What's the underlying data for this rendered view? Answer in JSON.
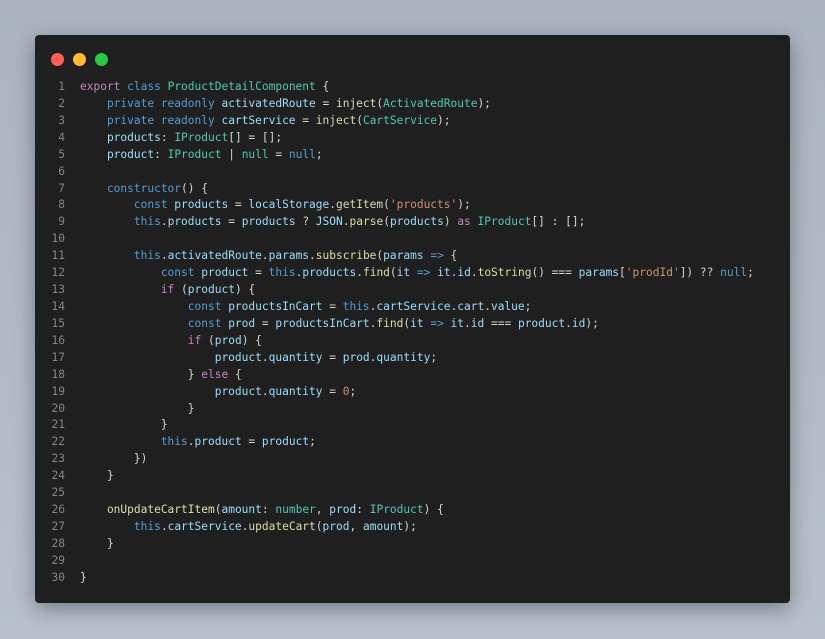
{
  "window": {
    "controls": [
      {
        "name": "close",
        "color": "#ff5f57"
      },
      {
        "name": "minimize",
        "color": "#febc2e"
      },
      {
        "name": "maximize",
        "color": "#28c840"
      }
    ]
  },
  "code": {
    "language": "typescript",
    "lines": [
      [
        [
          "export ",
          "c"
        ],
        [
          "class ",
          "k"
        ],
        [
          "ProductDetailComponent ",
          "t"
        ],
        [
          "{",
          "p"
        ]
      ],
      [
        [
          "    private readonly ",
          "k"
        ],
        [
          "activatedRoute",
          "v"
        ],
        [
          " = ",
          "p"
        ],
        [
          "inject",
          "f"
        ],
        [
          "(",
          "p"
        ],
        [
          "ActivatedRoute",
          "t"
        ],
        [
          ");",
          "p"
        ]
      ],
      [
        [
          "    private readonly ",
          "k"
        ],
        [
          "cartService",
          "v"
        ],
        [
          " = ",
          "p"
        ],
        [
          "inject",
          "f"
        ],
        [
          "(",
          "p"
        ],
        [
          "CartService",
          "t"
        ],
        [
          ");",
          "p"
        ]
      ],
      [
        [
          "    products",
          "v"
        ],
        [
          ": ",
          "p"
        ],
        [
          "IProduct",
          "t"
        ],
        [
          "[] = [];",
          "p"
        ]
      ],
      [
        [
          "    product",
          "v"
        ],
        [
          ": ",
          "p"
        ],
        [
          "IProduct",
          "t"
        ],
        [
          " | ",
          "p"
        ],
        [
          "null",
          "t"
        ],
        [
          " = ",
          "p"
        ],
        [
          "null",
          "k"
        ],
        [
          ";",
          "p"
        ]
      ],
      [],
      [
        [
          "    constructor",
          "k"
        ],
        [
          "() {",
          "p"
        ]
      ],
      [
        [
          "        const ",
          "k"
        ],
        [
          "products",
          "v"
        ],
        [
          " = ",
          "p"
        ],
        [
          "localStorage",
          "v"
        ],
        [
          ".",
          "p"
        ],
        [
          "getItem",
          "f"
        ],
        [
          "(",
          "p"
        ],
        [
          "'products'",
          "s"
        ],
        [
          ");",
          "p"
        ]
      ],
      [
        [
          "        this",
          "k"
        ],
        [
          ".",
          "p"
        ],
        [
          "products",
          "v"
        ],
        [
          " = ",
          "p"
        ],
        [
          "products",
          "v"
        ],
        [
          " ? ",
          "p"
        ],
        [
          "JSON",
          "v"
        ],
        [
          ".",
          "p"
        ],
        [
          "parse",
          "f"
        ],
        [
          "(",
          "p"
        ],
        [
          "products",
          "v"
        ],
        [
          ") ",
          "p"
        ],
        [
          "as ",
          "c"
        ],
        [
          "IProduct",
          "t"
        ],
        [
          "[] : [];",
          "p"
        ]
      ],
      [],
      [
        [
          "        this",
          "k"
        ],
        [
          ".",
          "p"
        ],
        [
          "activatedRoute",
          "v"
        ],
        [
          ".",
          "p"
        ],
        [
          "params",
          "v"
        ],
        [
          ".",
          "p"
        ],
        [
          "subscribe",
          "f"
        ],
        [
          "(",
          "p"
        ],
        [
          "params",
          "v"
        ],
        [
          " => ",
          "k"
        ],
        [
          "{",
          "p"
        ]
      ],
      [
        [
          "            const ",
          "k"
        ],
        [
          "product",
          "v"
        ],
        [
          " = ",
          "p"
        ],
        [
          "this",
          "k"
        ],
        [
          ".",
          "p"
        ],
        [
          "products",
          "v"
        ],
        [
          ".",
          "p"
        ],
        [
          "find",
          "f"
        ],
        [
          "(",
          "p"
        ],
        [
          "it",
          "v"
        ],
        [
          " => ",
          "k"
        ],
        [
          "it",
          "v"
        ],
        [
          ".",
          "p"
        ],
        [
          "id",
          "v"
        ],
        [
          ".",
          "p"
        ],
        [
          "toString",
          "f"
        ],
        [
          "() === ",
          "p"
        ],
        [
          "params",
          "v"
        ],
        [
          "[",
          "p"
        ],
        [
          "'prodId'",
          "s"
        ],
        [
          "]) ?? ",
          "p"
        ],
        [
          "null",
          "k"
        ],
        [
          ";",
          "p"
        ]
      ],
      [
        [
          "            if ",
          "c"
        ],
        [
          "(",
          "p"
        ],
        [
          "product",
          "v"
        ],
        [
          ") {",
          "p"
        ]
      ],
      [
        [
          "                const ",
          "k"
        ],
        [
          "productsInCart",
          "v"
        ],
        [
          " = ",
          "p"
        ],
        [
          "this",
          "k"
        ],
        [
          ".",
          "p"
        ],
        [
          "cartService",
          "v"
        ],
        [
          ".",
          "p"
        ],
        [
          "cart",
          "v"
        ],
        [
          ".",
          "p"
        ],
        [
          "value",
          "v"
        ],
        [
          ";",
          "p"
        ]
      ],
      [
        [
          "                const ",
          "k"
        ],
        [
          "prod",
          "v"
        ],
        [
          " = ",
          "p"
        ],
        [
          "productsInCart",
          "v"
        ],
        [
          ".",
          "p"
        ],
        [
          "find",
          "f"
        ],
        [
          "(",
          "p"
        ],
        [
          "it",
          "v"
        ],
        [
          " => ",
          "k"
        ],
        [
          "it",
          "v"
        ],
        [
          ".",
          "p"
        ],
        [
          "id",
          "v"
        ],
        [
          " === ",
          "p"
        ],
        [
          "product",
          "v"
        ],
        [
          ".",
          "p"
        ],
        [
          "id",
          "v"
        ],
        [
          ");",
          "p"
        ]
      ],
      [
        [
          "                if ",
          "c"
        ],
        [
          "(",
          "p"
        ],
        [
          "prod",
          "v"
        ],
        [
          ") {",
          "p"
        ]
      ],
      [
        [
          "                    product",
          "v"
        ],
        [
          ".",
          "p"
        ],
        [
          "quantity",
          "v"
        ],
        [
          " = ",
          "p"
        ],
        [
          "prod",
          "v"
        ],
        [
          ".",
          "p"
        ],
        [
          "quantity",
          "v"
        ],
        [
          ";",
          "p"
        ]
      ],
      [
        [
          "                } ",
          "p"
        ],
        [
          "else ",
          "c"
        ],
        [
          "{",
          "p"
        ]
      ],
      [
        [
          "                    product",
          "v"
        ],
        [
          ".",
          "p"
        ],
        [
          "quantity",
          "v"
        ],
        [
          " = ",
          "p"
        ],
        [
          "0",
          "s"
        ],
        [
          ";",
          "p"
        ]
      ],
      [
        [
          "                }",
          "p"
        ]
      ],
      [
        [
          "            }",
          "p"
        ]
      ],
      [
        [
          "            this",
          "k"
        ],
        [
          ".",
          "p"
        ],
        [
          "product",
          "v"
        ],
        [
          " = ",
          "p"
        ],
        [
          "product",
          "v"
        ],
        [
          ";",
          "p"
        ]
      ],
      [
        [
          "        })",
          "p"
        ]
      ],
      [
        [
          "    }",
          "p"
        ]
      ],
      [],
      [
        [
          "    onUpdateCartItem",
          "f"
        ],
        [
          "(",
          "p"
        ],
        [
          "amount",
          "v"
        ],
        [
          ": ",
          "p"
        ],
        [
          "number",
          "t"
        ],
        [
          ", ",
          "p"
        ],
        [
          "prod",
          "v"
        ],
        [
          ": ",
          "p"
        ],
        [
          "IProduct",
          "t"
        ],
        [
          ") {",
          "p"
        ]
      ],
      [
        [
          "        this",
          "k"
        ],
        [
          ".",
          "p"
        ],
        [
          "cartService",
          "v"
        ],
        [
          ".",
          "p"
        ],
        [
          "updateCart",
          "f"
        ],
        [
          "(",
          "p"
        ],
        [
          "prod",
          "v"
        ],
        [
          ", ",
          "p"
        ],
        [
          "amount",
          "v"
        ],
        [
          ");",
          "p"
        ]
      ],
      [
        [
          "    }",
          "p"
        ]
      ],
      [],
      [
        [
          "}",
          "p"
        ]
      ]
    ]
  }
}
